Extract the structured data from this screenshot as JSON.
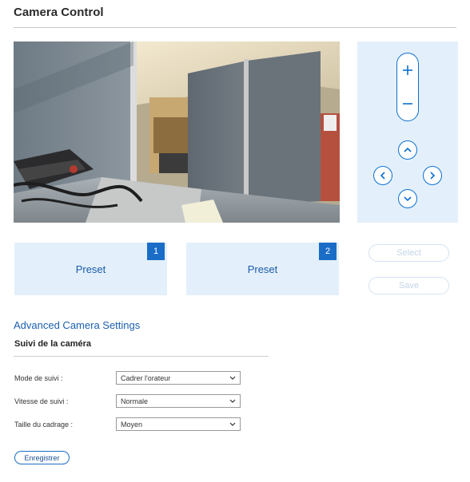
{
  "page": {
    "title": "Camera Control"
  },
  "ptz": {
    "zoom_in_icon": "plus-icon",
    "zoom_out_icon": "minus-icon",
    "directions": [
      "up",
      "left",
      "right",
      "down"
    ]
  },
  "presets": [
    {
      "label": "Preset",
      "number": "1"
    },
    {
      "label": "Preset",
      "number": "2"
    }
  ],
  "actions": {
    "select_label": "Select",
    "save_label": "Save"
  },
  "advanced": {
    "title": "Advanced Camera Settings",
    "subtitle": "Suivi de la caméra",
    "fields": [
      {
        "label": "Mode de suivi :",
        "value": "Cadrer l'orateur"
      },
      {
        "label": "Vitesse de suivi :",
        "value": "Normale"
      },
      {
        "label": "Taille du cadrage :",
        "value": "Moyen"
      }
    ],
    "submit_label": "Enregistrer"
  },
  "colors": {
    "accent": "#1a6dc7",
    "panel_bg": "#e3f0fb",
    "link": "#1b5fb0"
  }
}
